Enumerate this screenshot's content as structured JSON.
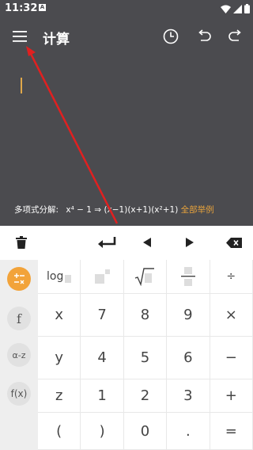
{
  "status_bar": {
    "time": "11:32",
    "app_badge": "A"
  },
  "toolbar": {
    "title": "计算"
  },
  "example": {
    "label": "多项式分解:",
    "formula": "x⁴ − 1 ⇒ (x−1)(x+1)(x²+1)",
    "more_link": "全部举例"
  },
  "keypad": {
    "rows": [
      [
        "log",
        "▪",
        "√",
        "frac",
        "÷"
      ],
      [
        "x",
        "7",
        "8",
        "9",
        "×"
      ],
      [
        "y",
        "4",
        "5",
        "6",
        "−"
      ],
      [
        "z",
        "1",
        "2",
        "3",
        "+"
      ],
      [
        "(",
        ")",
        "0",
        ".",
        "="
      ]
    ]
  },
  "left_tabs": [
    "±÷",
    "f",
    "α-z",
    "f(x)"
  ],
  "colors": {
    "dark_bg": "#4b4b4f",
    "accent": "#f2a33a",
    "arrow": "#e02020"
  }
}
